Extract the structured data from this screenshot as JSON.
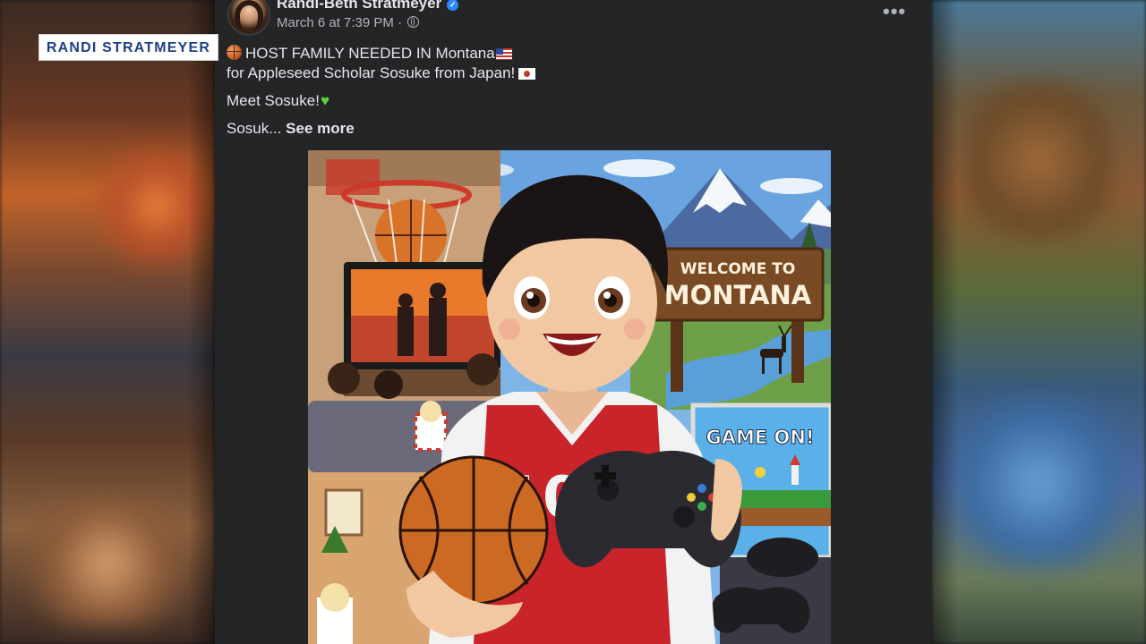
{
  "caption_name": "RANDI STRATMEYER",
  "post": {
    "author": "Randi-Beth Stratmeyer",
    "timestamp": "March 6 at 7:39 PM",
    "separator": "·",
    "line1": "HOST FAMILY NEEDED IN Montana",
    "line2": "for Appleseed Scholar Sosuke from Japan!",
    "line3": "Meet Sosuke!",
    "line4_text": "Sosuk...",
    "see_more": "See more"
  },
  "image": {
    "sign_line1": "WELCOME TO",
    "sign_line2": "MONTANA",
    "game_sign": "GAME ON!",
    "jersey_number": "10"
  },
  "icons": [
    "verified-badge-icon",
    "globe-icon",
    "more-options-icon",
    "basketball-emoji",
    "us-flag-emoji",
    "japan-flag-emoji",
    "green-heart-emoji"
  ],
  "colors": {
    "card_bg": "#242526",
    "text": "#e4e6eb",
    "muted": "#b0b3b8",
    "verified": "#2d88ff",
    "caption_text": "#1d3f8a"
  }
}
